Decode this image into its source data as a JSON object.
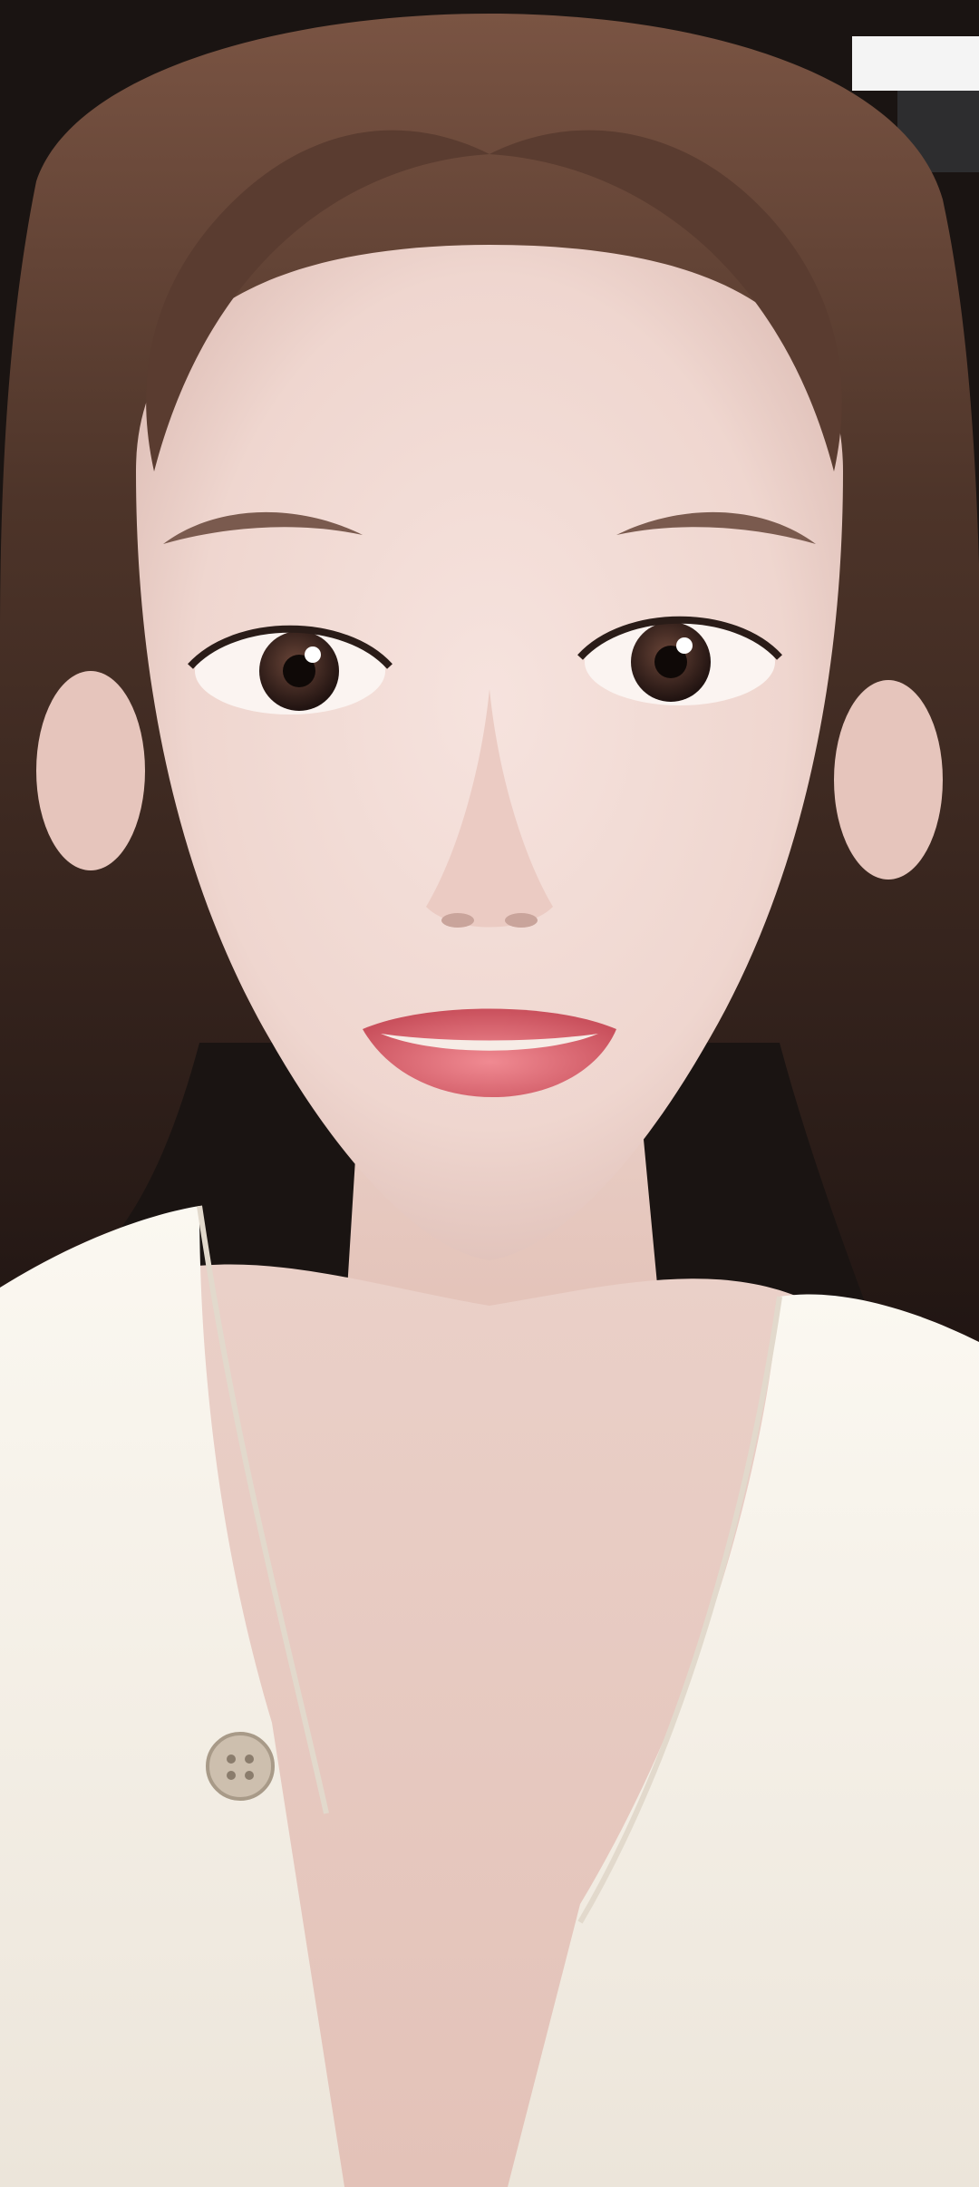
{
  "photo": {
    "subject": "portrait-selfie",
    "palette": {
      "background_dark": "#1a1412",
      "hair_light": "#6b4a3a",
      "hair_dark": "#2a1c18",
      "skin": "#f1d9d3",
      "skin_shadow": "#ddbdb5",
      "lips": "#e0707a",
      "iris": "#3a2520",
      "shirt": "#f6f2ea",
      "button": "#cdbfae",
      "ceiling": "#ffffff"
    }
  }
}
